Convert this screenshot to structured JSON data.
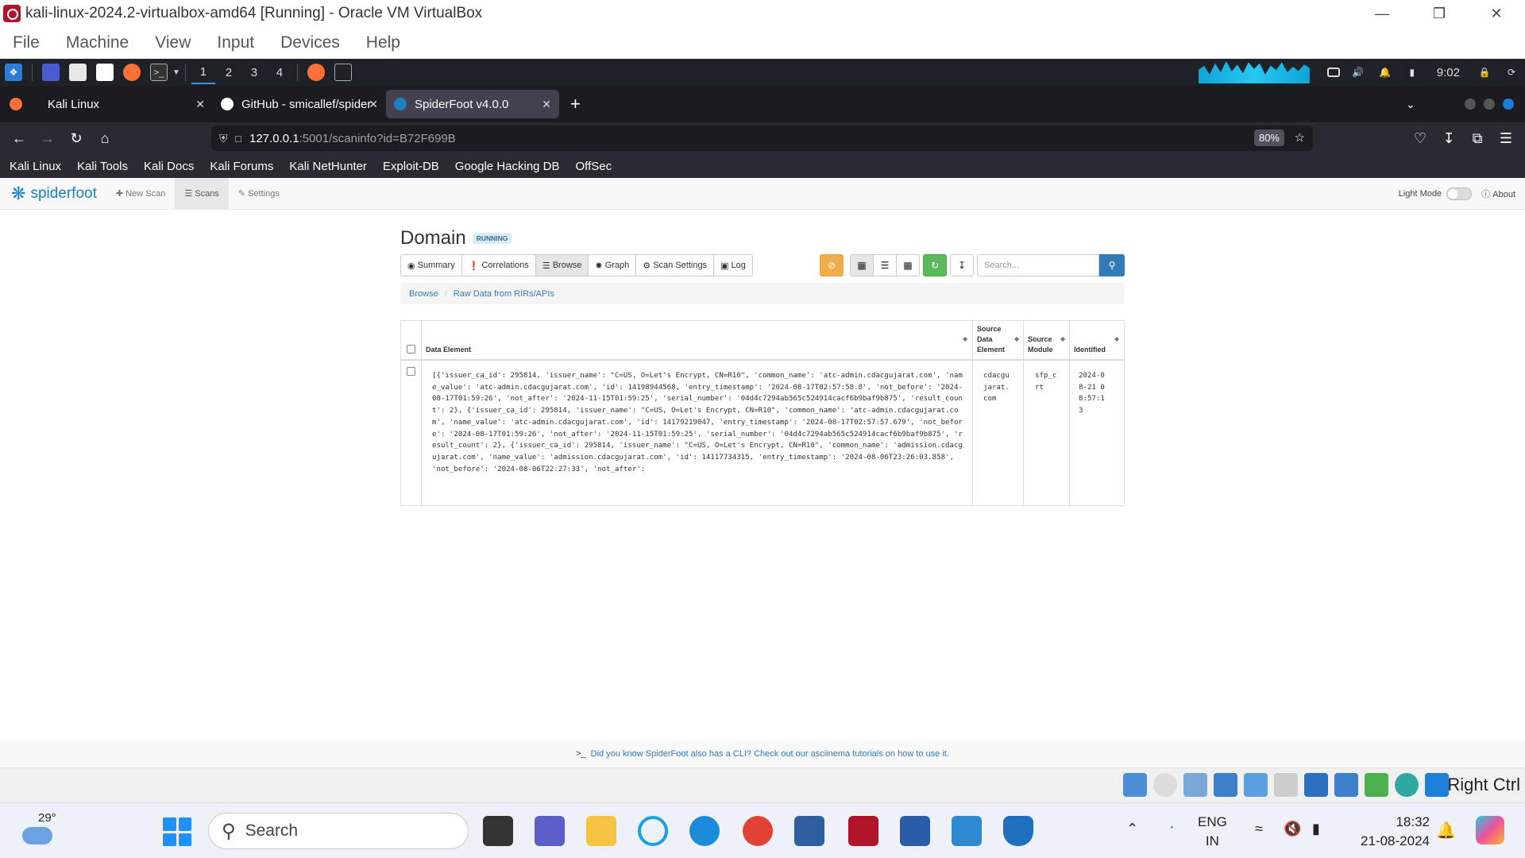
{
  "vbox": {
    "title": "kali-linux-2024.2-virtualbox-amd64 [Running] - Oracle VM VirtualBox",
    "menu": [
      "File",
      "Machine",
      "View",
      "Input",
      "Devices",
      "Help"
    ],
    "status_right": "Right Ctrl"
  },
  "kali_panel": {
    "workspaces": [
      "1",
      "2",
      "3",
      "4"
    ],
    "time": "9:02"
  },
  "firefox": {
    "tabs": [
      {
        "title": "Kali Linux"
      },
      {
        "title": "GitHub - smicallef/spider"
      },
      {
        "title": "SpiderFoot v4.0.0"
      }
    ],
    "url_host": "127.0.0.1",
    "url_rest": ":5001/scaninfo?id=B72F699B",
    "zoom": "80%",
    "bookmarks": [
      "Kali Linux",
      "Kali Tools",
      "Kali Docs",
      "Kali Forums",
      "Kali NetHunter",
      "Exploit-DB",
      "Google Hacking DB",
      "OffSec"
    ]
  },
  "sf": {
    "logo": "spiderfoot",
    "nav": [
      "New Scan",
      "Scans",
      "Settings"
    ],
    "light_mode": "Light Mode",
    "about": "About",
    "scan_title": "Domain",
    "status": "RUNNING",
    "tabs": [
      "Summary",
      "Correlations",
      "Browse",
      "Graph",
      "Scan Settings",
      "Log"
    ],
    "search_placeholder": "Search...",
    "breadcrumb": [
      "Browse",
      "Raw Data from RIRs/APIs"
    ],
    "table": {
      "headers": [
        "Data Element",
        "Source Data Element",
        "Source Module",
        "Identified"
      ],
      "row": {
        "data": "[{'issuer_ca_id': 295814, 'issuer_name': \"C=US, O=Let's Encrypt, CN=R10\", 'common_name': 'atc-admin.cdacgujarat.com', 'name_value': 'atc-admin.cdacgujarat.com', 'id': 14198944568, 'entry_timestamp': '2024-08-17T02:57:58.8', 'not_before': '2024-08-17T01:59:26', 'not_after': '2024-11-15T01:59:25', 'serial_number': '04d4c7294ab565c524914cacf6b9baf9b875', 'result_count': 2}, {'issuer_ca_id': 295814, 'issuer_name': \"C=US, O=Let's Encrypt, CN=R10\", 'common_name': 'atc-admin.cdacgujarat.com', 'name_value': 'atc-admin.cdacgujarat.com', 'id': 14179219047, 'entry_timestamp': '2024-08-17T02:57:57.679', 'not_before': '2024-08-17T01:59:26', 'not_after': '2024-11-15T01:59:25', 'serial_number': '04d4c7294ab565c524914cacf6b9baf9b875', 'result_count': 2}, {'issuer_ca_id': 295814, 'issuer_name': \"C=US, O=Let's Encrypt, CN=R10\", 'common_name': 'admission.cdacgujarat.com', 'name_value': 'admission.cdacgujarat.com', 'id': 14117734315, 'entry_timestamp': '2024-08-06T23:26:03.858', 'not_before': '2024-08-06T22:27:33', 'not_after':",
        "source": "cdacgujarat.com",
        "module": "sfp_crt",
        "identified": "2024-08-21 08:57:13"
      }
    },
    "footer": "Did you know SpiderFoot also has a CLI? Check out our asciinema tutorials on how to use it."
  },
  "taskbar": {
    "temperature": "29°",
    "search": "Search",
    "lang1": "ENG",
    "lang2": "IN",
    "time": "18:32",
    "date": "21-08-2024"
  }
}
